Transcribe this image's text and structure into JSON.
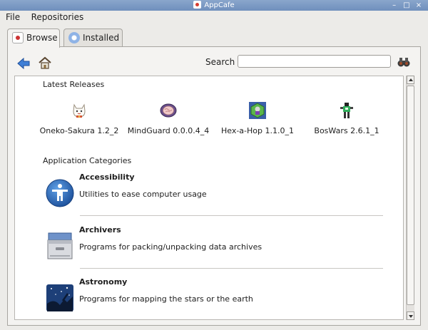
{
  "window": {
    "title": "AppCafe",
    "controls": [
      "–",
      "□",
      "×"
    ]
  },
  "menubar": [
    {
      "label": "File"
    },
    {
      "label": "Repositories"
    }
  ],
  "tabs": [
    {
      "label": "Browse",
      "active": true
    },
    {
      "label": "Installed",
      "active": false
    }
  ],
  "toolbar": {
    "search_label": "Search",
    "search_value": ""
  },
  "latest_releases": {
    "title": "Latest Releases",
    "items": [
      {
        "name": "Oneko-Sakura 1.2_2",
        "icon": "cat-icon"
      },
      {
        "name": "MindGuard 0.0.0.4_4",
        "icon": "brain-icon"
      },
      {
        "name": "Hex-a-Hop 1.1.0_1",
        "icon": "hex-a-hop-icon"
      },
      {
        "name": "BosWars 2.6.1_1",
        "icon": "robot-icon"
      }
    ]
  },
  "categories": {
    "title": "Application Categories",
    "items": [
      {
        "name": "Accessibility",
        "description": "Utilities to ease computer usage",
        "icon": "accessibility-icon"
      },
      {
        "name": "Archivers",
        "description": "Programs for packing/unpacking data archives",
        "icon": "archive-icon"
      },
      {
        "name": "Astronomy",
        "description": "Programs for mapping the stars or the earth",
        "icon": "astronomy-icon"
      }
    ]
  }
}
